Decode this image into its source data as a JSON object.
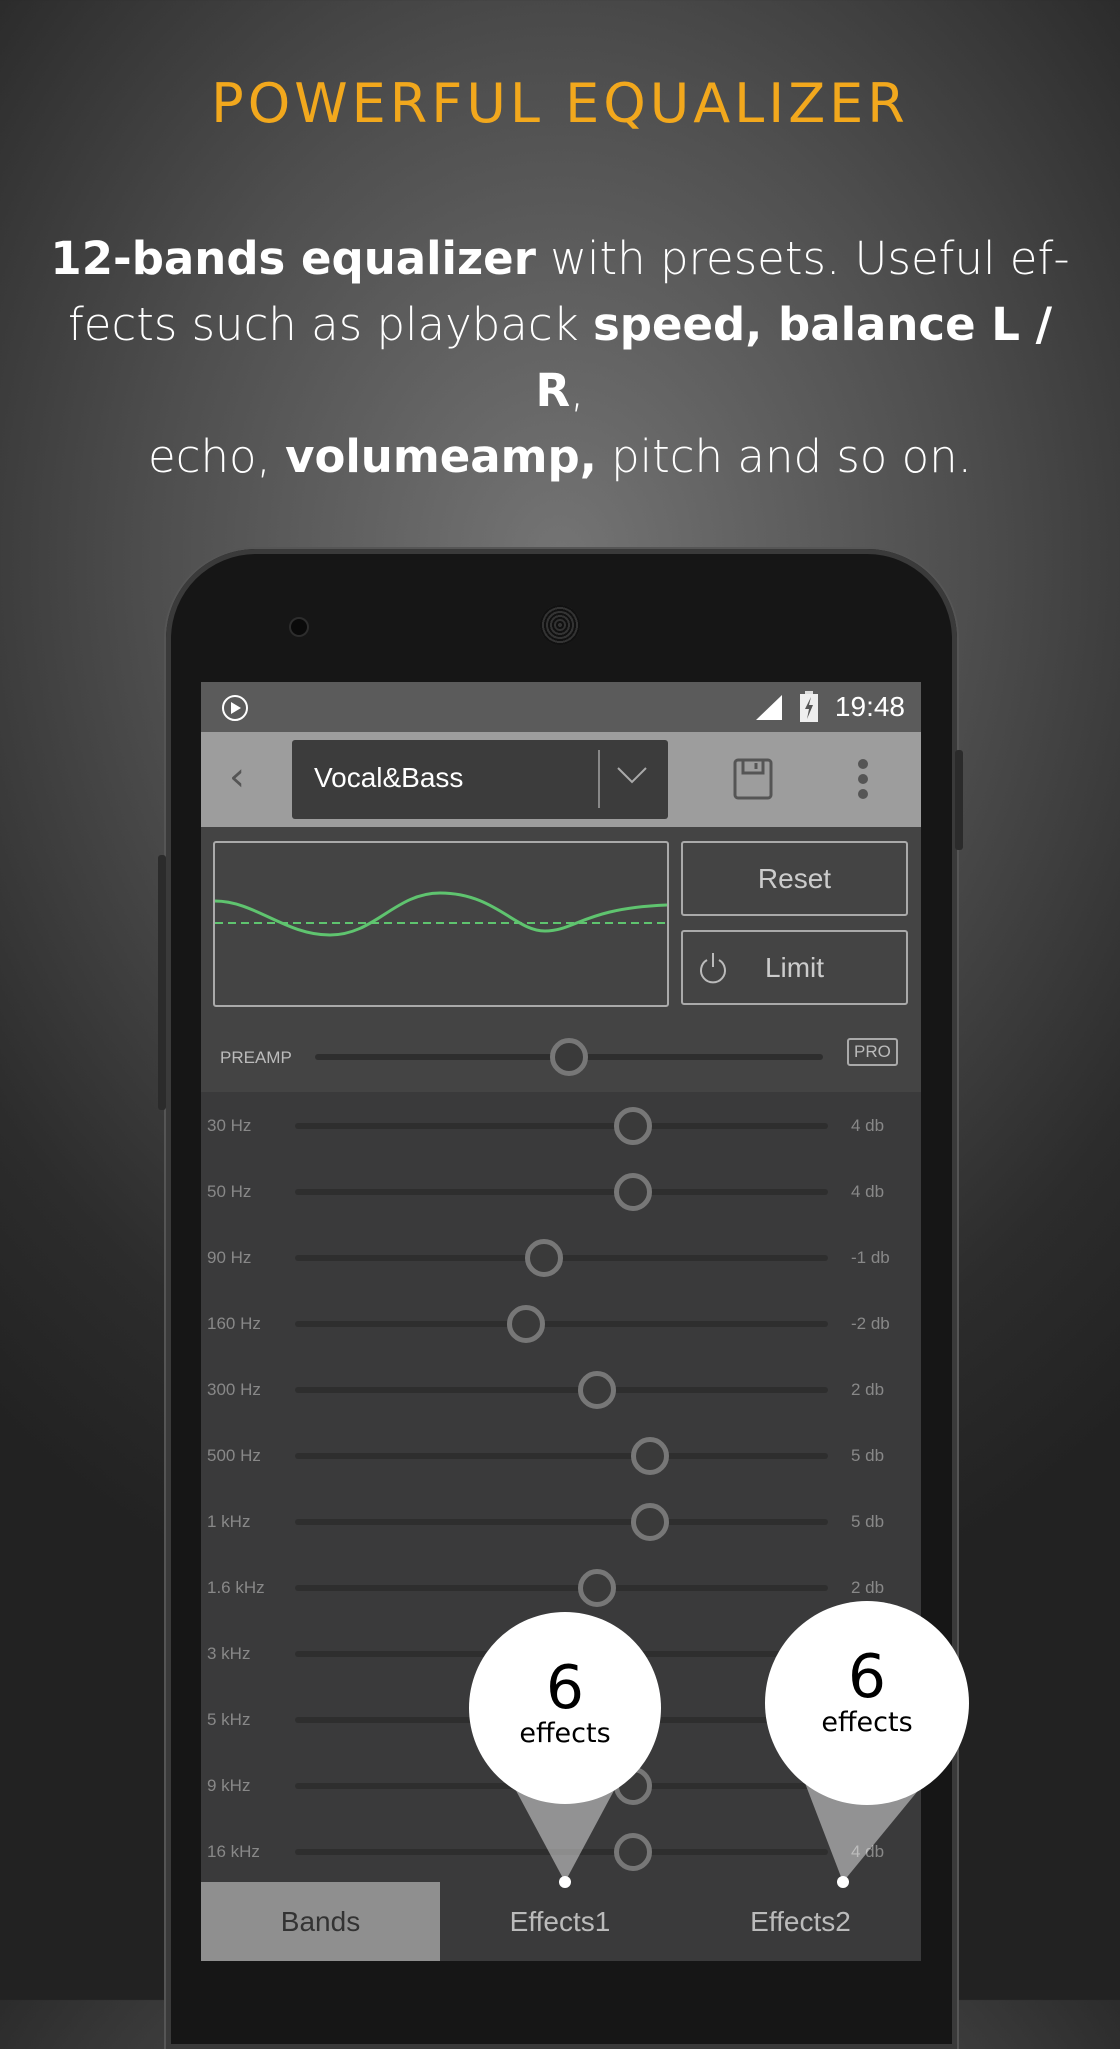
{
  "promo": {
    "headline": "POWERFUL EQUALIZER",
    "line1_bold": "12-bands equalizer",
    "line1_rest": " with presets. Useful ef-",
    "line2_start": "fects such as playback ",
    "line2_bold": "speed, balance L / R",
    "line2_end": ",",
    "line3_start": "echo, ",
    "line3_bold": "volumeamp,",
    "line3_end": " pitch and so on."
  },
  "status_bar": {
    "time": "19:48",
    "icons": [
      "play-circle-icon",
      "signal-icon",
      "battery-charging-icon"
    ]
  },
  "toolbar": {
    "preset": "Vocal&Bass",
    "icons": [
      "back-icon",
      "chevron-down-icon",
      "save-icon",
      "more-vert-icon"
    ]
  },
  "controls": {
    "reset_label": "Reset",
    "limit_label": "Limit",
    "preamp_label": "PREAMP",
    "preamp_level_db": 0,
    "pro_badge": "PRO"
  },
  "curve_color": "#5fc46f",
  "bands": [
    {
      "label": "30 Hz",
      "value": "4 db",
      "level_db": 4
    },
    {
      "label": "50 Hz",
      "value": "4 db",
      "level_db": 4
    },
    {
      "label": "90 Hz",
      "value": "-1 db",
      "level_db": -1
    },
    {
      "label": "160 Hz",
      "value": "-2 db",
      "level_db": -2
    },
    {
      "label": "300 Hz",
      "value": "2 db",
      "level_db": 2
    },
    {
      "label": "500 Hz",
      "value": "5 db",
      "level_db": 5
    },
    {
      "label": "1 kHz",
      "value": "5 db",
      "level_db": 5
    },
    {
      "label": "1.6 kHz",
      "value": "2 db",
      "level_db": 2
    },
    {
      "label": "3 kHz",
      "value": "",
      "level_db": null
    },
    {
      "label": "5 kHz",
      "value": "",
      "level_db": null
    },
    {
      "label": "9 kHz",
      "value": "",
      "level_db": 4
    },
    {
      "label": "16 kHz",
      "value": "4 db",
      "level_db": 4
    }
  ],
  "tabs": [
    {
      "label": "Bands",
      "active": true
    },
    {
      "label": "Effects1",
      "active": false
    },
    {
      "label": "Effects2",
      "active": false
    }
  ],
  "callouts": [
    {
      "count": "6",
      "text": "effects"
    },
    {
      "count": "6",
      "text": "effects"
    }
  ]
}
